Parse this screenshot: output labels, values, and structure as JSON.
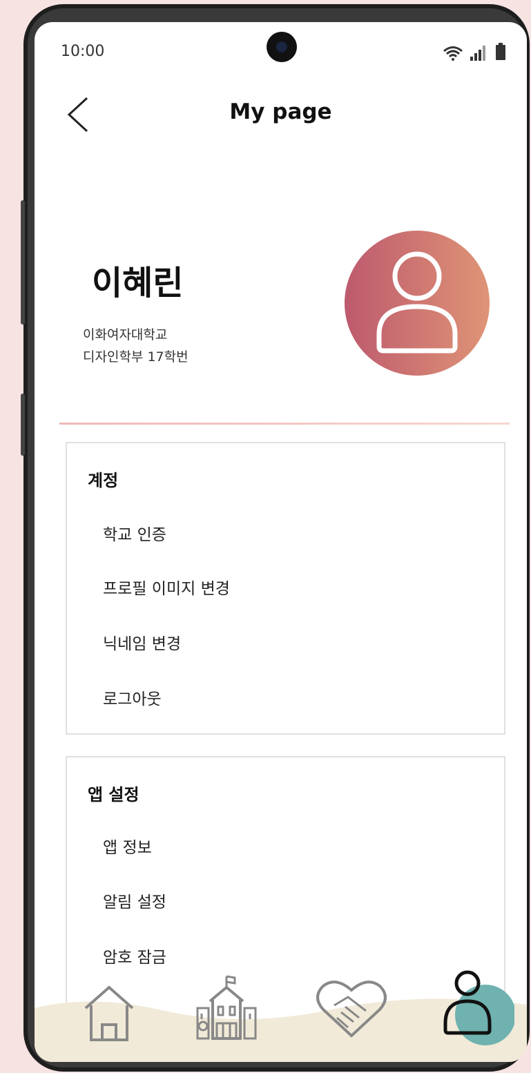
{
  "status_bar": {
    "time": "10:00"
  },
  "header": {
    "title": "My page"
  },
  "profile": {
    "name": "이혜린",
    "school_line1": "이화여자대학교",
    "school_line2": "디자인학부 17학번"
  },
  "account_section": {
    "title": "계정",
    "items": [
      "학교 인증",
      "프로필 이미지 변경",
      "닉네임 변경",
      "로그아웃"
    ]
  },
  "app_section": {
    "title": "앱 설정",
    "items": [
      "앱 정보",
      "알림 설정",
      "암호 잠금"
    ]
  },
  "tab_bar": {
    "tabs": [
      "home-icon",
      "school-icon",
      "handshake-icon",
      "profile-icon"
    ],
    "active_tab": "profile-icon",
    "active_color": "#6fb2b0",
    "background_color": "#f1ead8"
  },
  "colors": {
    "avatar_gradient_start": "#bd5a6e",
    "avatar_gradient_end": "#df9476",
    "page_background": "#f8e3e3"
  }
}
